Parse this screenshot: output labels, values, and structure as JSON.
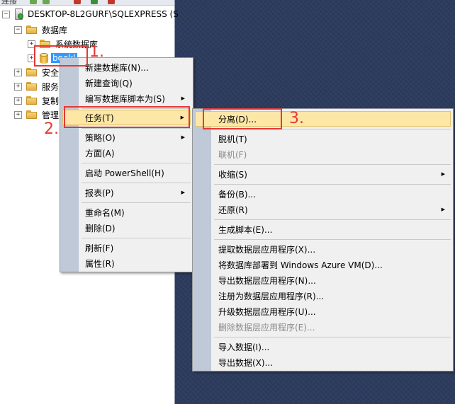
{
  "toolbar": {
    "partial_label": "连接"
  },
  "tree": {
    "server": {
      "label": "DESKTOP-8L2GURF\\SQLEXPRESS (S"
    },
    "databases": {
      "label": "数据库"
    },
    "system_databases": {
      "label": "系统数据库"
    },
    "selected_db": {
      "label": "bookl"
    },
    "security": {
      "label": "安全"
    },
    "server_objects": {
      "label": "服务"
    },
    "replication": {
      "label": "复制"
    },
    "management": {
      "label": "管理"
    },
    "expander_plus": "+",
    "expander_minus": "−"
  },
  "context_menu": {
    "items": [
      {
        "label": "新建数据库(N)..."
      },
      {
        "label": "新建查询(Q)"
      },
      {
        "label": "编写数据库脚本为(S)"
      },
      {
        "label": "任务(T)"
      },
      {
        "label": "策略(O)"
      },
      {
        "label": "方面(A)"
      },
      {
        "label": "启动 PowerShell(H)"
      },
      {
        "label": "报表(P)"
      },
      {
        "label": "重命名(M)"
      },
      {
        "label": "删除(D)"
      },
      {
        "label": "刷新(F)"
      },
      {
        "label": "属性(R)"
      }
    ],
    "submenu_arrow": "▶"
  },
  "tasks_submenu": {
    "items": [
      {
        "label": "分离(D)..."
      },
      {
        "label": "脱机(T)"
      },
      {
        "label": "联机(F)"
      },
      {
        "label": "收缩(S)"
      },
      {
        "label": "备份(B)..."
      },
      {
        "label": "还原(R)"
      },
      {
        "label": "生成脚本(E)..."
      },
      {
        "label": "提取数据层应用程序(X)..."
      },
      {
        "label": "将数据库部署到 Windows Azure VM(D)..."
      },
      {
        "label": "导出数据层应用程序(N)..."
      },
      {
        "label": "注册为数据层应用程序(R)..."
      },
      {
        "label": "升级数据层应用程序(U)..."
      },
      {
        "label": "删除数据层应用程序(E)..."
      },
      {
        "label": "导入数据(I)..."
      },
      {
        "label": "导出数据(X)..."
      }
    ]
  },
  "annotations": {
    "step1": "1.",
    "step2": "2.",
    "step3": "3."
  },
  "colors": {
    "annotation": "#e53935",
    "highlight": "#fce7a7",
    "selection": "#3399ff"
  }
}
